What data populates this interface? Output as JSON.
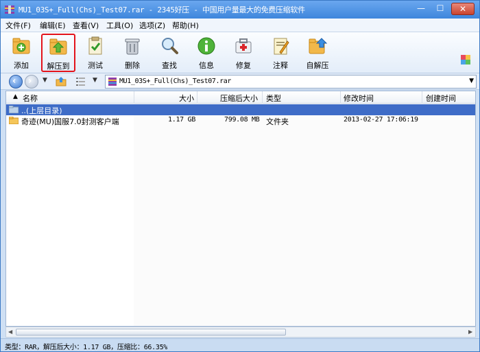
{
  "window": {
    "title": "MU1_03S+_Full(Chs)_Test07.rar - 2345好压 - 中国用户量最大的免费压缩软件",
    "min_glyph": "—",
    "max_glyph": "☐",
    "close_glyph": "✕"
  },
  "menu": [
    "文件(F)",
    "编辑(E)",
    "查看(V)",
    "工具(O)",
    "选项(Z)",
    "帮助(H)"
  ],
  "toolbar": [
    {
      "label": "添加",
      "icon": "add-archive-icon"
    },
    {
      "label": "解压到",
      "icon": "extract-to-icon"
    },
    {
      "label": "测试",
      "icon": "test-icon"
    },
    {
      "label": "删除",
      "icon": "delete-icon"
    },
    {
      "label": "查找",
      "icon": "search-icon"
    },
    {
      "label": "信息",
      "icon": "info-icon"
    },
    {
      "label": "修复",
      "icon": "repair-icon"
    },
    {
      "label": "注释",
      "icon": "comment-icon"
    },
    {
      "label": "自解压",
      "icon": "self-extract-icon"
    }
  ],
  "address": {
    "path": "MU1_03S+_Full(Chs)_Test07.rar"
  },
  "columns": [
    "名称",
    "大小",
    "压缩后大小",
    "类型",
    "修改时间",
    "创建时间"
  ],
  "rows": [
    {
      "name": "..(上层目录)",
      "size": "",
      "packed": "",
      "type": "",
      "modified": "",
      "created": ""
    },
    {
      "name": "奇迹(MU)国服7.0封测客户端",
      "size": "1.17 GB",
      "packed": "799.08 MB",
      "type": "文件夹",
      "modified": "2013-02-27 17:06:19",
      "created": ""
    }
  ],
  "status": {
    "text": "类型：RAR，解压后大小：1.17 GB，压缩比：66.35%"
  },
  "colors": {
    "title_bar": "#3e86dc",
    "selection": "#3e6cc7",
    "highlight_border": "#e3121a"
  }
}
